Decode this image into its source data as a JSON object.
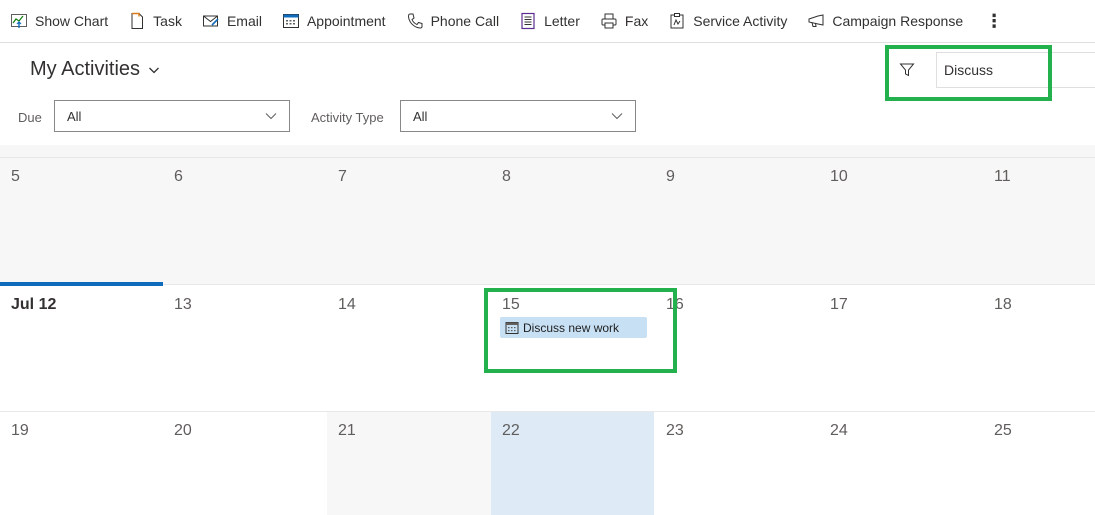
{
  "command_bar": {
    "items": [
      {
        "label": "Show Chart",
        "icon": "chart-icon"
      },
      {
        "label": "Task",
        "icon": "task-icon"
      },
      {
        "label": "Email",
        "icon": "email-icon"
      },
      {
        "label": "Appointment",
        "icon": "calendar-icon"
      },
      {
        "label": "Phone Call",
        "icon": "phone-icon"
      },
      {
        "label": "Letter",
        "icon": "letter-icon"
      },
      {
        "label": "Fax",
        "icon": "fax-icon"
      },
      {
        "label": "Service Activity",
        "icon": "service-activity-icon"
      },
      {
        "label": "Campaign Response",
        "icon": "megaphone-icon"
      }
    ],
    "more_label": "⋮"
  },
  "header": {
    "view_title": "My Activities",
    "search": {
      "value": "Discuss",
      "icon": "filter-icon"
    }
  },
  "filters": {
    "due": {
      "label": "Due",
      "value": "All"
    },
    "activity_type": {
      "label": "Activity Type",
      "value": "All"
    }
  },
  "calendar": {
    "colors": {
      "today_accent": "#0f6cbd",
      "selected_day": "#deebf7",
      "past_day": "#f7f7f7",
      "event_bg": "#c7e0f4",
      "highlight": "#22b14c"
    },
    "weeks": [
      {
        "days": [
          "5",
          "6",
          "7",
          "8",
          "9",
          "10",
          "11"
        ]
      },
      {
        "days": [
          "Jul 12",
          "13",
          "14",
          "15",
          "16",
          "17",
          "18"
        ]
      },
      {
        "days": [
          "19",
          "20",
          "21",
          "22",
          "23",
          "24",
          "25"
        ]
      }
    ],
    "events": [
      {
        "day": "15",
        "title": "Discuss new work",
        "icon": "appointment-icon"
      }
    ]
  }
}
